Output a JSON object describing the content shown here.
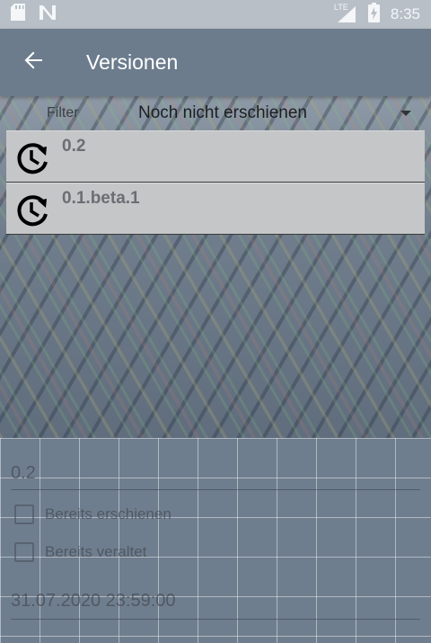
{
  "status_bar": {
    "network": "LTE",
    "time": "8:35"
  },
  "app_bar": {
    "title": "Versionen"
  },
  "filter": {
    "label": "Filter",
    "selected": "Noch nicht erschienen"
  },
  "versions": [
    {
      "label": "0.2"
    },
    {
      "label": "0.1.beta.1"
    }
  ],
  "detail": {
    "version_value": "0.2",
    "released_label": "Bereits erschienen",
    "deprecated_label": "Bereits veraltet",
    "date_value": "31.07.2020 23:59:00"
  },
  "icons": {
    "back": "arrow-left-icon",
    "version_item": "history-clock-icon",
    "sd_card": "sd-card-icon",
    "notification": "n-notification-icon",
    "signal": "signal-icon",
    "battery": "battery-charging-icon"
  }
}
